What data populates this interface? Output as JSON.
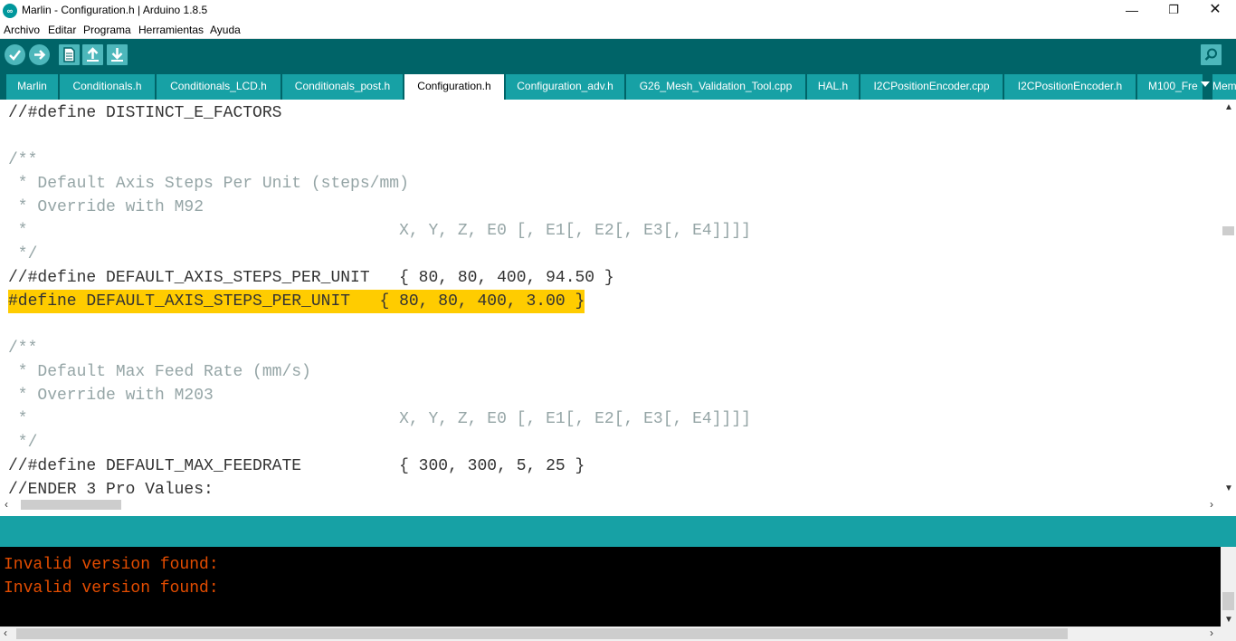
{
  "window": {
    "title": "Marlin - Configuration.h | Arduino 1.8.5",
    "app_icon_glyph": "∞",
    "minimize_glyph": "—",
    "maximize_glyph": "❐",
    "close_glyph": "✕"
  },
  "menu": {
    "items": [
      "Archivo",
      "Editar",
      "Programa",
      "Herramientas",
      "Ayuda"
    ]
  },
  "toolbar": {
    "buttons": [
      {
        "name": "verify",
        "icon": "check-icon"
      },
      {
        "name": "upload",
        "icon": "arrow-right-icon"
      },
      {
        "name": "new",
        "icon": "new-file-icon"
      },
      {
        "name": "open",
        "icon": "arrow-up-icon"
      },
      {
        "name": "save",
        "icon": "arrow-down-icon"
      },
      {
        "name": "serial-monitor",
        "icon": "magnifier-icon"
      }
    ]
  },
  "tabs": {
    "items": [
      "Marlin",
      "Conditionals.h",
      "Conditionals_LCD.h",
      "Conditionals_post.h",
      "Configuration.h",
      "Configuration_adv.h",
      "G26_Mesh_Validation_Tool.cpp",
      "HAL.h",
      "I2CPositionEncoder.cpp",
      "I2CPositionEncoder.h",
      "M100_Fre",
      "Mem"
    ],
    "active_index": 4,
    "tab_menu_icon": "dropdown-arrow-icon"
  },
  "editor": {
    "lines": [
      "//#define DISTINCT_E_FACTORS",
      "",
      "/**",
      " * Default Axis Steps Per Unit (steps/mm)",
      " * Override with M92",
      " *                                      X, Y, Z, E0 [, E1[, E2[, E3[, E4]]]]",
      " */",
      "//#define DEFAULT_AXIS_STEPS_PER_UNIT   { 80, 80, 400, 94.50 }",
      "#define DEFAULT_AXIS_STEPS_PER_UNIT   { 80, 80, 400, 3.00 }",
      "",
      "/**",
      " * Default Max Feed Rate (mm/s)",
      " * Override with M203",
      " *                                      X, Y, Z, E0 [, E1[, E2[, E3[, E4]]]]",
      " */",
      "//#define DEFAULT_MAX_FEEDRATE          { 300, 300, 5, 25 }",
      "//ENDER 3 Pro Values:"
    ],
    "highlighted_line_index": 8,
    "highlight_color": "#ffcc00"
  },
  "console": {
    "lines": [
      "Invalid version found:",
      "Invalid version found:"
    ],
    "text_color": "#e34c00"
  },
  "colors": {
    "toolbar_bg": "#006468",
    "tab_bg": "#17a1a5",
    "status_bg": "#17a1a5",
    "console_bg": "#000000"
  }
}
